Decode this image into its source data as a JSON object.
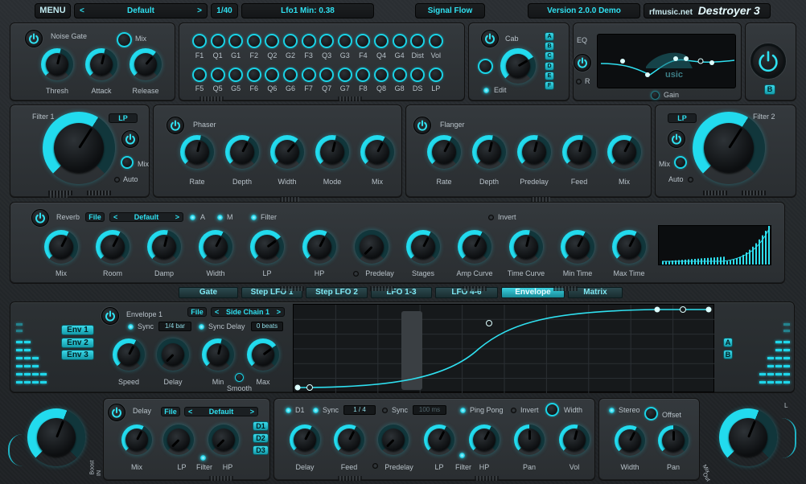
{
  "header": {
    "menu": "MENU",
    "preset_prev": "<",
    "preset_name": "Default",
    "preset_next": ">",
    "page_counter": "1/40",
    "readout": "Lfo1 Min: 0.38",
    "signal_flow": "Signal Flow",
    "version": "Version 2.0.0  Demo",
    "site": "rfmusic.net",
    "product": "Destroyer 3"
  },
  "noise_gate": {
    "title": "Noise Gate",
    "mix": "Mix",
    "knobs": [
      "Thresh",
      "Attack",
      "Release"
    ]
  },
  "eq_bands": {
    "top": [
      "F1",
      "Q1",
      "G1",
      "F2",
      "Q2",
      "G2",
      "F3",
      "Q3",
      "G3",
      "F4",
      "Q4",
      "G4",
      "Dist",
      "Vol"
    ],
    "bottom": [
      "F5",
      "Q5",
      "G5",
      "F6",
      "Q6",
      "G6",
      "F7",
      "Q7",
      "G7",
      "F8",
      "Q8",
      "G8",
      "DS",
      "LP"
    ]
  },
  "cab": {
    "title": "Cab",
    "edit": "Edit",
    "slots": [
      "A",
      "B",
      "C",
      "D",
      "E",
      "F"
    ]
  },
  "eq": {
    "title": "EQ",
    "r": "R",
    "gain": "Gain",
    "graph_text": "usic"
  },
  "out": {
    "b": "B"
  },
  "filter1": {
    "title": "Filter 1",
    "type": "LP",
    "mix": "Mix",
    "auto": "Auto"
  },
  "phaser": {
    "title": "Phaser",
    "knobs": [
      "Rate",
      "Depth",
      "Width",
      "Mode",
      "Mix"
    ]
  },
  "flanger": {
    "title": "Flanger",
    "knobs": [
      "Rate",
      "Depth",
      "Predelay",
      "Feed",
      "Mix"
    ]
  },
  "filter2": {
    "title": "Filter 2",
    "type": "LP",
    "mix": "Mix",
    "auto": "Auto"
  },
  "reverb": {
    "title": "Reverb",
    "file": "File",
    "prev": "<",
    "preset": "Default",
    "next": ">",
    "a": "A",
    "m": "M",
    "filter": "Filter",
    "invert": "Invert",
    "predelay": "Predelay",
    "knobs": [
      "Mix",
      "Room",
      "Damp",
      "Width",
      "LP",
      "HP",
      "Predelay",
      "Stages",
      "Amp Curve",
      "Time Curve",
      "Min Time",
      "Max Time"
    ]
  },
  "tabs": [
    {
      "label": "Gate",
      "active": false
    },
    {
      "label": "Step LFO 1",
      "active": false
    },
    {
      "label": "Step LFO 2",
      "active": false
    },
    {
      "label": "LFO 1-3",
      "active": false
    },
    {
      "label": "LFO 4-6",
      "active": false
    },
    {
      "label": "Envelope",
      "active": true
    },
    {
      "label": "Matrix",
      "active": false
    }
  ],
  "envelope": {
    "title": "Envelope 1",
    "file": "File",
    "prev": "<",
    "source": "Side Chain 1",
    "next": ">",
    "sync": "Sync",
    "sync_value": "1/4 bar",
    "sync_delay": "Sync Delay",
    "sync_delay_value": "0 beats",
    "envs": [
      "Env 1",
      "Env 2",
      "Env 3"
    ],
    "knobs": [
      "Speed",
      "Delay",
      "Min",
      "Max"
    ],
    "smooth": "Smooth",
    "ab": [
      "A",
      "B"
    ]
  },
  "io": {
    "boost": "Boost",
    "in": "IN",
    "mix": "Mix",
    "out": "Out",
    "l": "L"
  },
  "delay": {
    "title": "Delay",
    "file": "File",
    "prev": "<",
    "preset": "Default",
    "next": ">",
    "d_buttons": [
      "D1",
      "D2",
      "D3"
    ],
    "knobs": [
      "Mix",
      "LP",
      "Filter",
      "HP"
    ]
  },
  "delay2": {
    "d1": "D1",
    "sync": "Sync",
    "sync_value": "1 / 4",
    "sync2": "Sync",
    "sync2_value": "100 ms",
    "ping_pong": "Ping Pong",
    "invert": "Invert",
    "width": "Width",
    "predelay": "Predelay",
    "filter": "Filter",
    "knobs": [
      "Delay",
      "Feed",
      "Predelay",
      "LP",
      "HP",
      "Pan",
      "Vol"
    ]
  },
  "stereo": {
    "title": "Stereo",
    "offset": "Offset",
    "knobs": [
      "Width",
      "Pan"
    ]
  },
  "colors": {
    "accent": "#2fe0f0",
    "panel": "#2e3336"
  }
}
